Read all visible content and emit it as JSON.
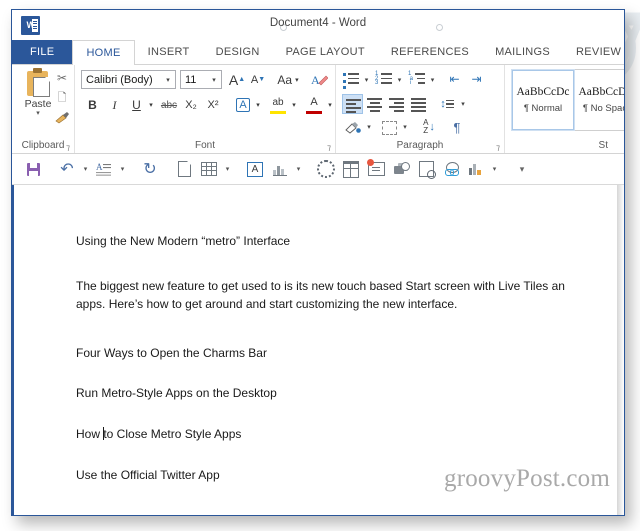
{
  "window": {
    "title": "Document4 - Word",
    "app_icon": "word-icon",
    "accent_color": "#2b579a"
  },
  "ribbon": {
    "tabs": [
      {
        "label": "FILE",
        "active": false,
        "is_file": true
      },
      {
        "label": "HOME",
        "active": true,
        "is_file": false
      },
      {
        "label": "INSERT",
        "active": false,
        "is_file": false
      },
      {
        "label": "DESIGN",
        "active": false,
        "is_file": false
      },
      {
        "label": "PAGE LAYOUT",
        "active": false,
        "is_file": false
      },
      {
        "label": "REFERENCES",
        "active": false,
        "is_file": false
      },
      {
        "label": "MAILINGS",
        "active": false,
        "is_file": false
      },
      {
        "label": "REVIEW",
        "active": false,
        "is_file": false
      }
    ],
    "groups": {
      "clipboard": {
        "label": "Clipboard",
        "paste_label": "Paste",
        "paste_caret": "▾",
        "cut_icon": "scissors-icon",
        "copy_icon": "copy-icon",
        "format_painter_icon": "paintbrush-icon",
        "dialog_launcher": "⁊"
      },
      "font": {
        "label": "Font",
        "font_name": "Calibri (Body)",
        "font_size": "11",
        "caret": "▾",
        "grow_font": "A",
        "shrink_font": "A",
        "change_case": "Aa",
        "clear_formatting": "clear-formatting-icon",
        "bold": "B",
        "italic": "I",
        "underline": "U",
        "strikethrough": "abc",
        "subscript": "X₂",
        "superscript": "X²",
        "text_effects": "A",
        "highlight": "ab",
        "highlight_color": "#ffe400",
        "font_color": "A",
        "font_color_value": "#c00000",
        "dialog_launcher": "⁊"
      },
      "paragraph": {
        "label": "Paragraph",
        "caret": "▾",
        "bullets": "bullets-icon",
        "numbering": "numbering-icon",
        "multilevel": "multilevel-list-icon",
        "decrease_indent": "⇤",
        "increase_indent": "⇥",
        "align_left": "align-left-icon",
        "align_center": "align-center-icon",
        "align_right": "align-right-icon",
        "align_justify": "align-justify-icon",
        "line_spacing": "↕",
        "shading": "shading-icon",
        "borders": "borders-icon",
        "sort": "A\nZ↓",
        "show_marks": "¶",
        "dialog_launcher": "⁊",
        "selected_alignment": "align-left"
      },
      "styles": {
        "label": "St",
        "items": [
          {
            "preview": "AaBbCcDc",
            "name": "¶ Normal",
            "selected": true
          },
          {
            "preview": "AaBbCcDc",
            "name": "¶ No Spac",
            "selected": false
          }
        ]
      }
    }
  },
  "quick_access": {
    "buttons": [
      {
        "name": "save",
        "icon": "save-icon",
        "caret": false
      },
      {
        "name": "undo",
        "icon": "undo-icon",
        "caret": true,
        "caret_glyph": "▾"
      },
      {
        "name": "repeat-typing",
        "icon": "repeat-style-icon",
        "caret": true,
        "caret_glyph": "▾"
      },
      {
        "name": "redo",
        "icon": "redo-icon",
        "caret": false
      },
      {
        "name": "new-blank-document",
        "icon": "new-document-icon",
        "caret": false
      },
      {
        "name": "insert-table",
        "icon": "table-icon",
        "caret": true,
        "caret_glyph": "▾"
      },
      {
        "name": "text-box",
        "icon": "text-box-icon",
        "caret": false
      },
      {
        "name": "building-blocks",
        "icon": "building-blocks-icon",
        "caret": true,
        "caret_glyph": "▾"
      },
      {
        "name": "smartart",
        "icon": "smartart-icon",
        "caret": false
      },
      {
        "name": "table-properties",
        "icon": "table-grid-icon",
        "caret": false
      },
      {
        "name": "business-card",
        "icon": "contact-card-icon",
        "caret": false
      },
      {
        "name": "envelopes-labels",
        "icon": "mail-merge-icon",
        "caret": false
      },
      {
        "name": "print-preview",
        "icon": "print-preview-icon",
        "caret": false
      },
      {
        "name": "hyperlink",
        "icon": "hyperlink-icon",
        "caret": false
      },
      {
        "name": "insert-chart",
        "icon": "chart-icon",
        "caret": true,
        "caret_glyph": "▾"
      },
      {
        "name": "customize-toolbar",
        "icon": "overflow-chevron-icon",
        "caret": false,
        "glyph": "▾"
      }
    ]
  },
  "document": {
    "heading": "Using the New Modern “metro” Interface",
    "body_line_1": "The biggest new feature to get used to is its new touch based Start screen with Live Tiles an",
    "body_line_2": "apps. Here’s how to get around and start customizing the new interface.",
    "list": [
      {
        "text": "Four Ways to Open the Charms Bar",
        "caret_after": null
      },
      {
        "text": "Run Metro-Style Apps on the Desktop",
        "caret_after": null
      },
      {
        "text_before": "How ",
        "text_after": "to Close Metro Style Apps",
        "caret_after": true
      },
      {
        "text": "Use the Official Twitter App",
        "caret_after": null
      }
    ],
    "watermark": "groovyPost.com"
  }
}
